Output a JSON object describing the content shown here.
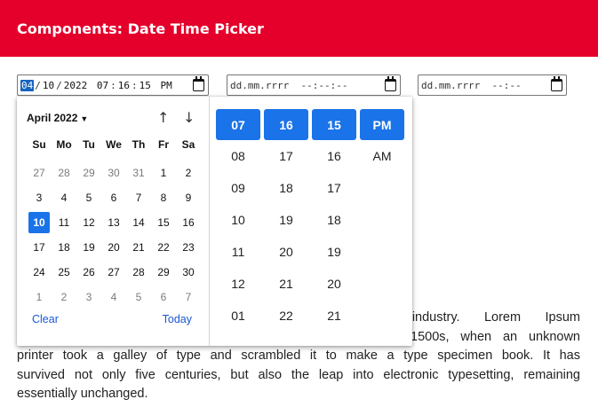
{
  "header": {
    "title": "Components: Date Time Picker"
  },
  "inputs": [
    {
      "segments": [
        "04",
        "10",
        "2022"
      ],
      "time": [
        "07",
        "16",
        "15",
        "PM"
      ],
      "selected_segment": 0
    },
    {
      "placeholder_date": "dd.mm.rrrr",
      "placeholder_time": "--:--:--"
    },
    {
      "placeholder_date": "dd.mm.rrrr",
      "placeholder_time": "--:--"
    }
  ],
  "calendar": {
    "month_label": "April 2022",
    "dropdown_glyph": "▼",
    "nav_up": "↑",
    "nav_down": "↓",
    "weekdays": [
      "Su",
      "Mo",
      "Tu",
      "We",
      "Th",
      "Fr",
      "Sa"
    ],
    "weeks": [
      [
        "27",
        "28",
        "29",
        "30",
        "31",
        "1",
        "2"
      ],
      [
        "3",
        "4",
        "5",
        "6",
        "7",
        "8",
        "9"
      ],
      [
        "10",
        "11",
        "12",
        "13",
        "14",
        "15",
        "16"
      ],
      [
        "17",
        "18",
        "19",
        "20",
        "21",
        "22",
        "23"
      ],
      [
        "24",
        "25",
        "26",
        "27",
        "28",
        "29",
        "30"
      ],
      [
        "1",
        "2",
        "3",
        "4",
        "5",
        "6",
        "7"
      ]
    ],
    "muted": {
      "0": [
        0,
        1,
        2,
        3,
        4
      ],
      "5": [
        0,
        1,
        2,
        3,
        4,
        5,
        6
      ]
    },
    "selected": {
      "week": 2,
      "day": 0
    },
    "clear_label": "Clear",
    "today_label": "Today"
  },
  "time_picker": {
    "hours": {
      "selected": "07",
      "items": [
        "08",
        "09",
        "10",
        "11",
        "12",
        "01"
      ]
    },
    "minutes": {
      "selected": "16",
      "items": [
        "17",
        "18",
        "19",
        "20",
        "21",
        "22"
      ]
    },
    "seconds": {
      "selected": "15",
      "items": [
        "16",
        "17",
        "18",
        "19",
        "20",
        "21"
      ]
    },
    "ampm": {
      "selected": "PM",
      "items": [
        "AM"
      ]
    }
  },
  "paragraph": {
    "lines": [
      "ting industry. Lorem Ipsum",
      "1500s, when an unknown",
      "printer took a galley of type and scrambled it to make a type specimen book. It has",
      "survived not only five centuries, but also the leap into electronic typesetting, remaining",
      "essentially unchanged."
    ]
  },
  "colors": {
    "header_bg": "#e4002b",
    "accent": "#1a73e8",
    "link": "#1a56db"
  }
}
